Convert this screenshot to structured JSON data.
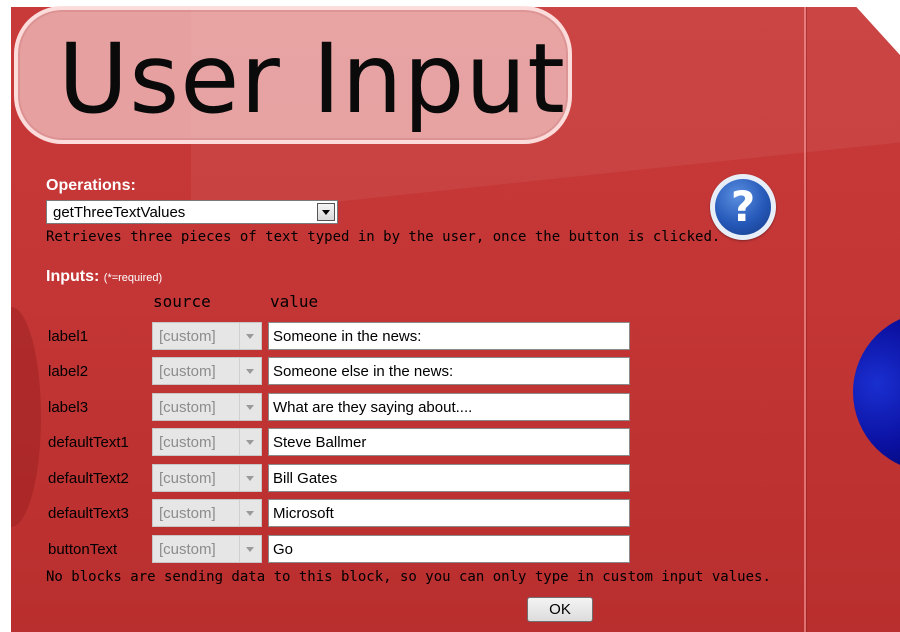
{
  "header": {
    "title": "User Input"
  },
  "help": {
    "glyph": "?"
  },
  "operations": {
    "label": "Operations:",
    "selected": "getThreeTextValues",
    "description": "Retrieves three pieces of text typed in by the user, once the button is clicked."
  },
  "inputs": {
    "label": "Inputs:",
    "required_note": "(*=required)",
    "columns": {
      "source": "source",
      "value": "value"
    },
    "rows": [
      {
        "name": "label1",
        "source": "[custom]",
        "value": "Someone in the news:"
      },
      {
        "name": "label2",
        "source": "[custom]",
        "value": "Someone else in the news:"
      },
      {
        "name": "label3",
        "source": "[custom]",
        "value": "What are they saying about...."
      },
      {
        "name": "defaultText1",
        "source": "[custom]",
        "value": "Steve Ballmer"
      },
      {
        "name": "defaultText2",
        "source": "[custom]",
        "value": "Bill Gates"
      },
      {
        "name": "defaultText3",
        "source": "[custom]",
        "value": "Microsoft"
      },
      {
        "name": "buttonText",
        "source": "[custom]",
        "value": "Go"
      }
    ],
    "footer_note": "No blocks are sending data to this block, so you can only type in custom input values."
  },
  "actions": {
    "ok_label": "OK"
  },
  "colors": {
    "panel_red": "#c43636",
    "title_pill": "#f0bebe",
    "help_blue": "#2558b8",
    "orb_blue": "#0a10a0"
  }
}
